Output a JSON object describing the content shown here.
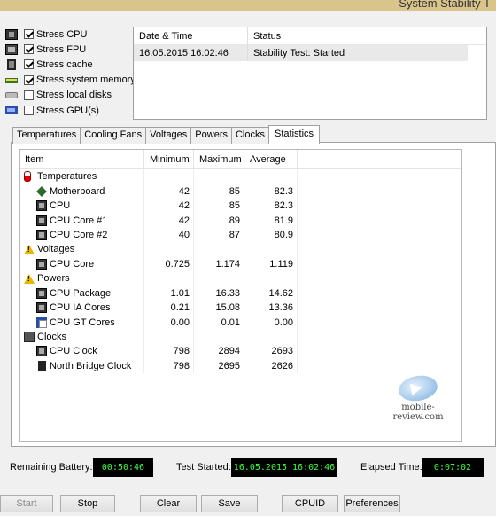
{
  "window": {
    "title": "System Stability T"
  },
  "stress_options": [
    {
      "label": "Stress CPU",
      "checked": true,
      "icon": "cpu-icon"
    },
    {
      "label": "Stress FPU",
      "checked": true,
      "icon": "fpu-icon"
    },
    {
      "label": "Stress cache",
      "checked": true,
      "icon": "cache-icon"
    },
    {
      "label": "Stress system memory",
      "checked": true,
      "icon": "memory-icon"
    },
    {
      "label": "Stress local disks",
      "checked": false,
      "icon": "disk-icon"
    },
    {
      "label": "Stress GPU(s)",
      "checked": false,
      "icon": "gpu-icon"
    }
  ],
  "log": {
    "headers": [
      "Date & Time",
      "Status"
    ],
    "rows": [
      {
        "datetime": "16.05.2015 16:02:46",
        "status": "Stability Test: Started"
      }
    ]
  },
  "tabs": [
    {
      "label": "Temperatures",
      "active": false
    },
    {
      "label": "Cooling Fans",
      "active": false
    },
    {
      "label": "Voltages",
      "active": false
    },
    {
      "label": "Powers",
      "active": false
    },
    {
      "label": "Clocks",
      "active": false
    },
    {
      "label": "Statistics",
      "active": true
    }
  ],
  "stats": {
    "headers": {
      "item": "Item",
      "min": "Minimum",
      "max": "Maximum",
      "avg": "Average"
    },
    "rows": [
      {
        "type": "group",
        "label": "Temperatures",
        "icon": "thermometer-icon"
      },
      {
        "type": "item",
        "label": "Motherboard",
        "icon": "motherboard-icon",
        "min": "42",
        "max": "85",
        "avg": "82.3"
      },
      {
        "type": "item",
        "label": "CPU",
        "icon": "cpu-chip-icon",
        "min": "42",
        "max": "85",
        "avg": "82.3"
      },
      {
        "type": "item",
        "label": "CPU Core #1",
        "icon": "cpu-chip-icon",
        "min": "42",
        "max": "89",
        "avg": "81.9"
      },
      {
        "type": "item",
        "label": "CPU Core #2",
        "icon": "cpu-chip-icon",
        "min": "40",
        "max": "87",
        "avg": "80.9"
      },
      {
        "type": "group",
        "label": "Voltages",
        "icon": "warning-icon"
      },
      {
        "type": "item",
        "label": "CPU Core",
        "icon": "cpu-chip-icon",
        "min": "0.725",
        "max": "1.174",
        "avg": "1.119"
      },
      {
        "type": "group",
        "label": "Powers",
        "icon": "warning-icon"
      },
      {
        "type": "item",
        "label": "CPU Package",
        "icon": "cpu-chip-icon",
        "min": "1.01",
        "max": "16.33",
        "avg": "14.62"
      },
      {
        "type": "item",
        "label": "CPU IA Cores",
        "icon": "cpu-chip-icon",
        "min": "0.21",
        "max": "15.08",
        "avg": "13.36"
      },
      {
        "type": "item",
        "label": "CPU GT Cores",
        "icon": "gpu-cores-icon",
        "min": "0.00",
        "max": "0.01",
        "avg": "0.00"
      },
      {
        "type": "group",
        "label": "Clocks",
        "icon": "clock-chip-icon"
      },
      {
        "type": "item",
        "label": "CPU Clock",
        "icon": "cpu-chip-icon",
        "min": "798",
        "max": "2894",
        "avg": "2693"
      },
      {
        "type": "item",
        "label": "North Bridge Clock",
        "icon": "northbridge-icon",
        "min": "798",
        "max": "2695",
        "avg": "2626"
      }
    ]
  },
  "watermark": {
    "text": "mobile-review.com"
  },
  "status": {
    "battery_label": "Remaining Battery:",
    "battery_value": "00:50:46",
    "started_label": "Test Started:",
    "started_value": "16.05.2015 16:02:46",
    "elapsed_label": "Elapsed Time:",
    "elapsed_value": "0:07:02"
  },
  "buttons": {
    "start": "Start",
    "stop": "Stop",
    "clear": "Clear",
    "save": "Save",
    "cpuid": "CPUID",
    "preferences": "Preferences"
  },
  "colors": {
    "lcd_text": "#3dff3d",
    "lcd_bg": "#000000",
    "titlebar": "#d9c58c"
  }
}
